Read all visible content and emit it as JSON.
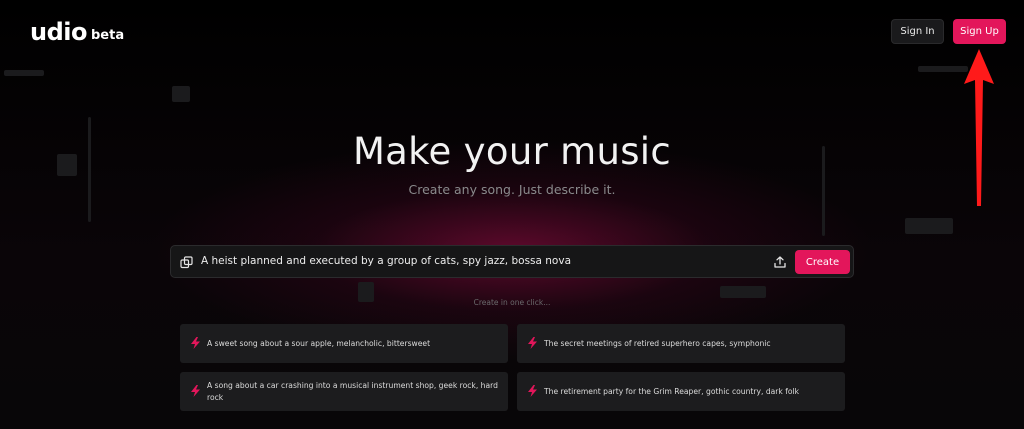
{
  "header": {
    "logo": "udio",
    "logo_badge": "beta",
    "sign_in_label": "Sign In",
    "sign_up_label": "Sign Up"
  },
  "hero": {
    "title": "Make your music",
    "subtitle": "Create any song. Just describe it."
  },
  "prompt": {
    "value": "A heist planned and executed by a group of cats, spy jazz, bossa nova",
    "create_label": "Create"
  },
  "suggestions": {
    "hint": "Create in one click...",
    "items": [
      "A sweet song about a sour apple, melancholic, bittersweet",
      "The secret meetings of retired superhero capes, symphonic",
      "A song about a car crashing into a musical instrument shop, geek rock, hard rock",
      "The retirement party for the Grim Reaper, gothic country, dark folk"
    ]
  },
  "colors": {
    "accent": "#e3165b",
    "background": "#000000",
    "card": "#1c1c1e",
    "annotation_arrow": "#ff1a1a"
  },
  "icons": {
    "prompt": "copy-icon",
    "upload": "upload-icon",
    "suggestion": "lightning-bolt-icon",
    "annotation": "red-arrow-pointing-up"
  }
}
